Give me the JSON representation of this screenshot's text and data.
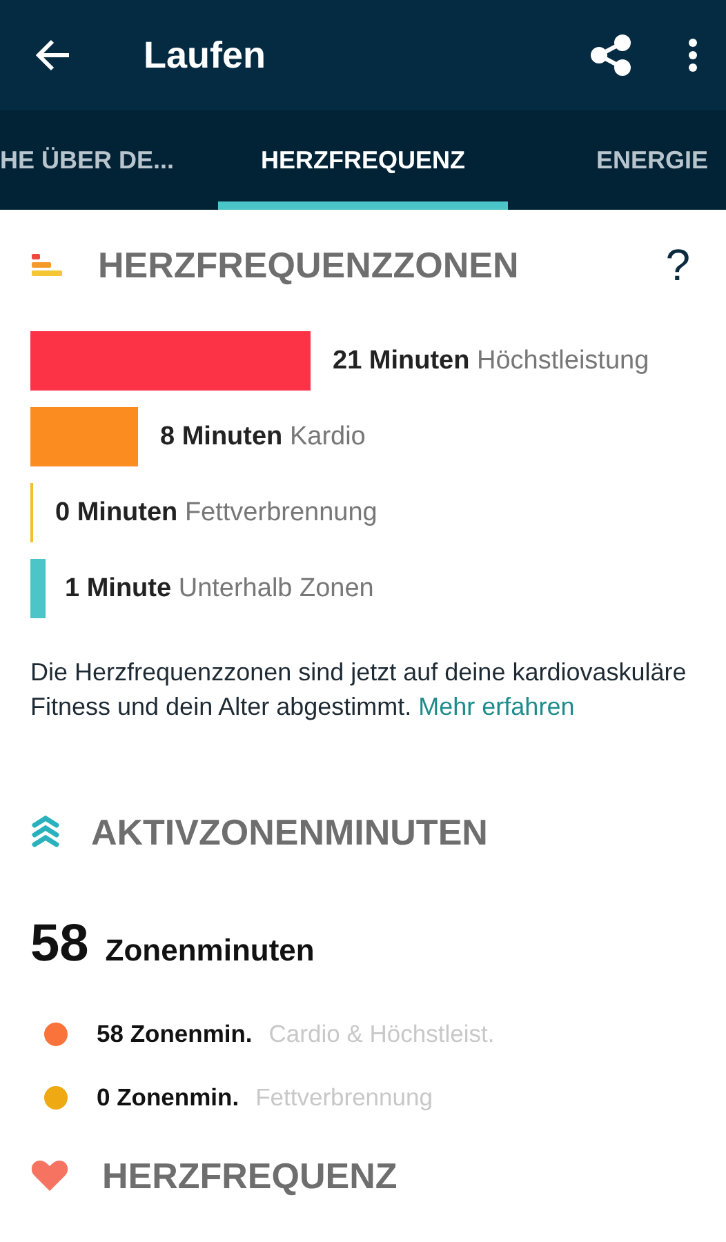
{
  "app_bar": {
    "title": "Laufen"
  },
  "tabs": [
    {
      "label": "HE ÜBER DE...",
      "selected": false
    },
    {
      "label": "HERZFREQUENZ",
      "selected": true
    },
    {
      "label": "ENERGIE",
      "selected": false
    }
  ],
  "heart_rate_zones": {
    "title": "HERZFREQUENZZONEN",
    "help": "?",
    "zones": [
      {
        "amount": "21 Minuten",
        "name": "Höchstleistung",
        "color": "#fc3346"
      },
      {
        "amount": "8 Minuten",
        "name": "Kardio",
        "color": "#fb8c1f"
      },
      {
        "amount": "0 Minuten",
        "name": "Fettverbrennung",
        "color": "#f4be2c"
      },
      {
        "amount": "1 Minute",
        "name": "Unterhalb Zonen",
        "color": "#4cc5c9"
      }
    ],
    "description": "Die Herzfrequenzzonen sind jetzt auf deine kardiovaskuläre Fitness und dein Alter abgestimmt.",
    "link": "Mehr erfahren"
  },
  "active_zone_minutes": {
    "title": "AKTIVZONENMINUTEN",
    "total": "58",
    "unit": "Zonenminuten",
    "items": [
      {
        "amount": "58 Zonenmin.",
        "name": "Cardio & Höchstleist.",
        "color": "#f9733b"
      },
      {
        "amount": "0 Zonenmin.",
        "name": "Fettverbrennung",
        "color": "#efa913"
      }
    ]
  },
  "heart_rate": {
    "title": "HERZFREQUENZ"
  }
}
